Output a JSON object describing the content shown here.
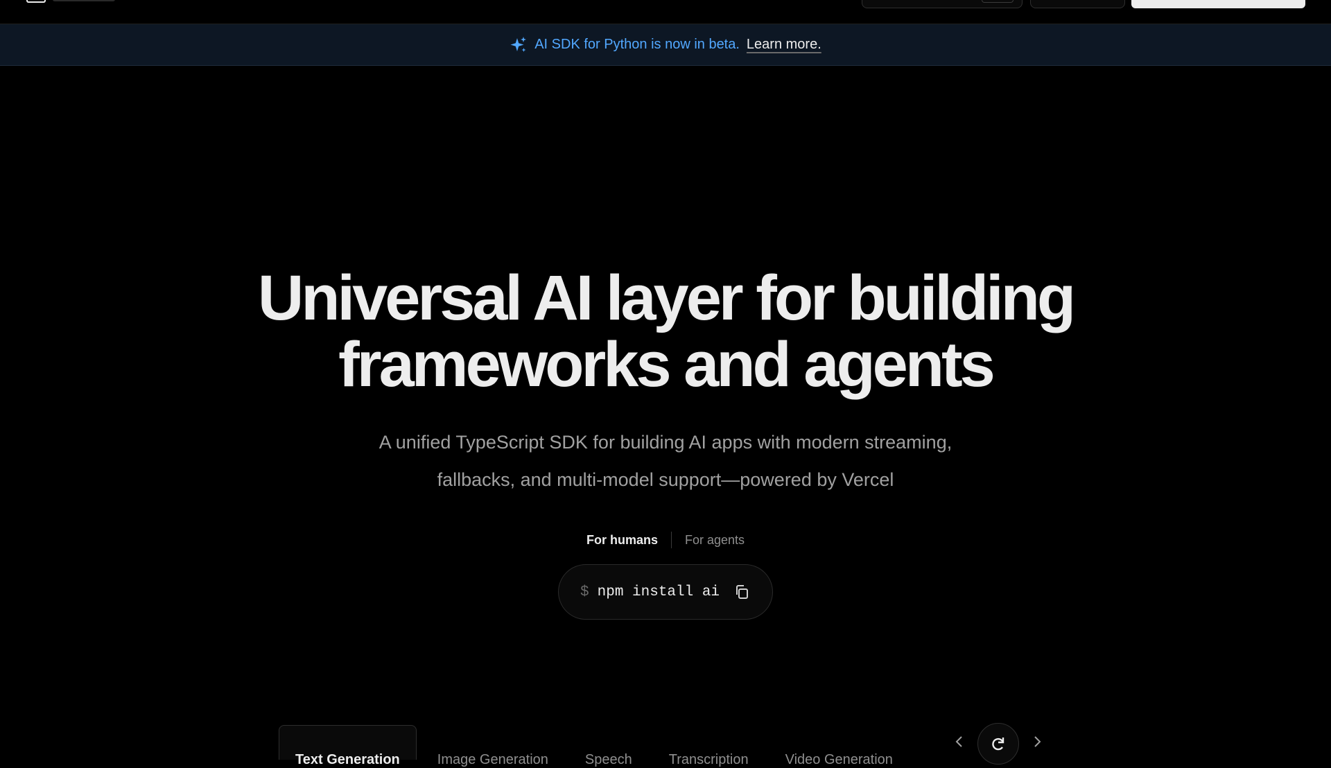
{
  "banner": {
    "text": "AI SDK for Python is now in beta.",
    "link": "Learn more.",
    "icon": "sparkles-icon",
    "accent": "#52a8ff"
  },
  "hero": {
    "title_line1": "Universal AI layer for building",
    "title_line2": "frameworks and agents",
    "subtitle_line1": "A unified TypeScript SDK for building AI apps with modern streaming,",
    "subtitle_line2": "fallbacks, and multi-model support—powered by Vercel"
  },
  "audience": {
    "humans": "For humans",
    "agents": "For agents"
  },
  "install": {
    "prompt": "$",
    "command": "npm install ai",
    "icon": "copy-icon"
  },
  "tabs": [
    {
      "label": "Text Generation"
    },
    {
      "label": "Image Generation"
    },
    {
      "label": "Speech"
    },
    {
      "label": "Transcription"
    },
    {
      "label": "Video Generation"
    }
  ],
  "colors": {
    "background": "#000000",
    "banner_bg": "#0d1724",
    "text": "#ededed",
    "muted": "#a1a1a1"
  }
}
